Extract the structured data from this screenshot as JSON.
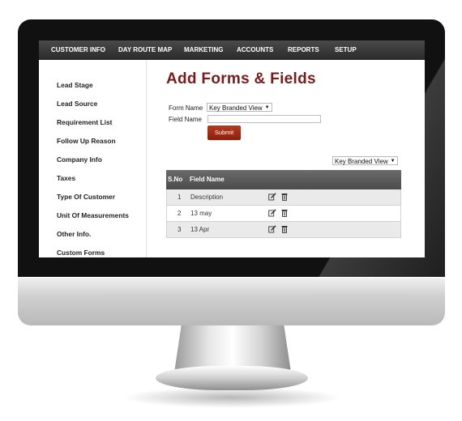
{
  "nav": {
    "items": [
      "CUSTOMER INFO",
      "DAY ROUTE MAP",
      "MARKETING",
      "ACCOUNTS",
      "REPORTS",
      "SETUP"
    ]
  },
  "sidebar": {
    "items": [
      "Lead Stage",
      "Lead Source",
      "Requirement List",
      "Follow Up Reason",
      "Company Info",
      "Taxes",
      "Type Of Customer",
      "Unit Of Measurements",
      "Other Info.",
      "Custom Forms"
    ]
  },
  "page": {
    "title": "Add Forms & Fields"
  },
  "form": {
    "form_name_label": "Form Name",
    "form_name_value": "Key Branded View",
    "field_name_label": "Field Name",
    "field_name_value": "",
    "submit_label": "Submit"
  },
  "filter": {
    "selected": "Key Branded View"
  },
  "table": {
    "headers": [
      "S.No",
      "Field Name"
    ],
    "rows": [
      {
        "sno": "1",
        "field": "Description"
      },
      {
        "sno": "2",
        "field": "13 may"
      },
      {
        "sno": "3",
        "field": "13 Apr"
      }
    ]
  },
  "icons": {
    "edit": "edit-icon",
    "delete": "trash-icon"
  },
  "colors": {
    "title": "#7b1a1a",
    "button": "#9c2a15",
    "nav": "#2a2a2a",
    "table_header": "#555555"
  }
}
